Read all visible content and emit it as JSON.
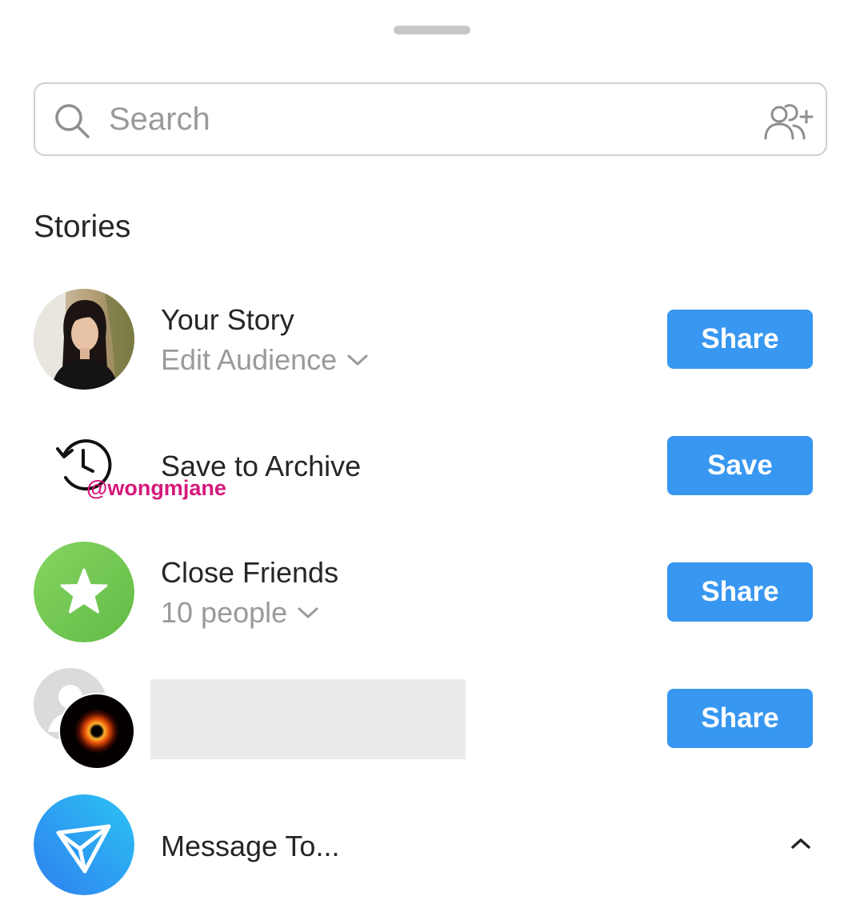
{
  "search": {
    "placeholder": "Search",
    "value": ""
  },
  "section": {
    "title": "Stories"
  },
  "rows": {
    "your_story": {
      "title": "Your Story",
      "subtitle": "Edit Audience",
      "button": "Share",
      "avatar_icon": "profile-photo"
    },
    "archive": {
      "title": "Save to Archive",
      "button": "Save",
      "icon": "history-clock-icon"
    },
    "close_friends": {
      "title": "Close Friends",
      "subtitle": "10 people",
      "button": "Share",
      "icon": "star-icon",
      "icon_color": "#78c850"
    },
    "group": {
      "title": "",
      "button": "Share"
    },
    "message": {
      "title": "Message To...",
      "icon": "paper-plane-icon"
    }
  },
  "watermark": {
    "text": "@wongmjane"
  },
  "colors": {
    "accent": "#3897f0",
    "secondary_text": "#9a9a9a",
    "watermark": "#d4197a"
  }
}
